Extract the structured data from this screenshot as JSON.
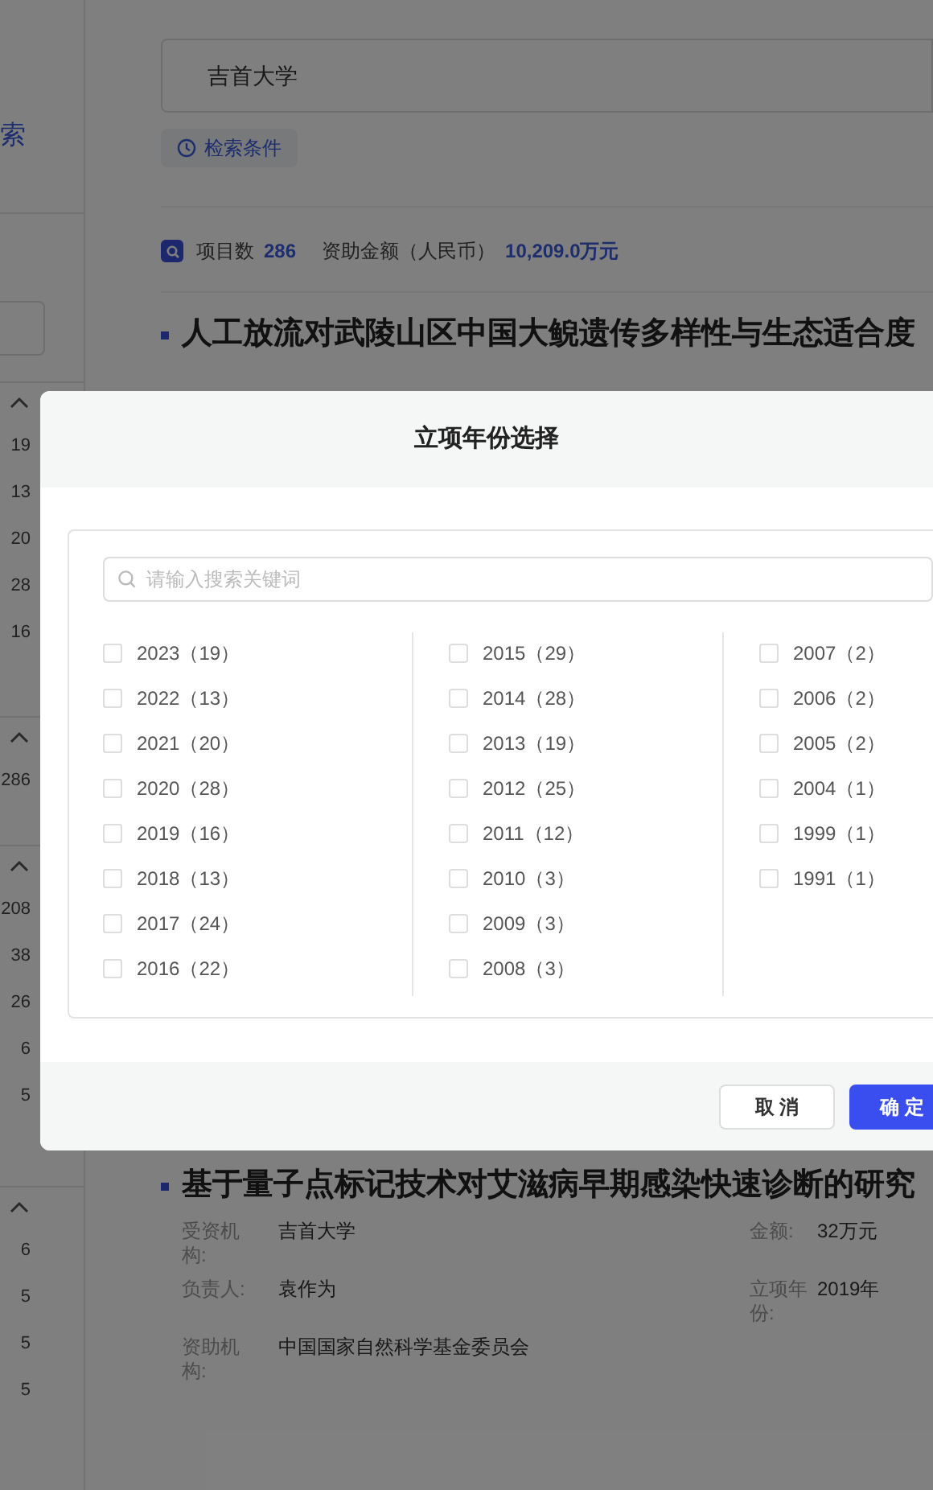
{
  "sidebar": {
    "link": "索",
    "sections": [
      {
        "expanded": true,
        "counts": [
          "19",
          "13",
          "20",
          "28",
          "16"
        ]
      },
      {
        "expanded": true,
        "counts": [
          "286"
        ]
      },
      {
        "expanded": true,
        "counts": [
          "208",
          "38",
          "26",
          "6",
          "5"
        ]
      },
      {
        "expanded": true,
        "counts": [
          "6",
          "5",
          "5",
          "5"
        ]
      }
    ]
  },
  "search": {
    "value": "吉首大学"
  },
  "conditions_button": "检索条件",
  "summary": {
    "count_label": "项目数",
    "count": "286",
    "amount_label": "资助金额（人民币）",
    "amount": "10,209.0万元"
  },
  "results": [
    {
      "title": "人工放流对武陵山区中国大鲵遗传多样性与生态适合度"
    },
    {
      "title": "基于量子点标记技术对艾滋病早期感染快速诊断的研究",
      "fields": [
        {
          "label": "受资机构:",
          "value": "吉首大学"
        },
        {
          "label": "金额:",
          "value": "32万元"
        },
        {
          "label": "负责人:",
          "value": "袁作为"
        },
        {
          "label": "立项年份:",
          "value": "2019年"
        },
        {
          "label": "资助机构:",
          "value": "中国国家自然科学基金委员会"
        }
      ]
    }
  ],
  "dialog": {
    "title": "立项年份选择",
    "search_placeholder": "请输入搜索关键词",
    "columns": [
      [
        {
          "label": "2023（19）",
          "checked": false
        },
        {
          "label": "2022（13）",
          "checked": false
        },
        {
          "label": "2021（20）",
          "checked": false
        },
        {
          "label": "2020（28）",
          "checked": false
        },
        {
          "label": "2019（16）",
          "checked": false
        },
        {
          "label": "2018（13）",
          "checked": false
        },
        {
          "label": "2017（24）",
          "checked": false
        },
        {
          "label": "2016（22）",
          "checked": false
        }
      ],
      [
        {
          "label": "2015（29）",
          "checked": false
        },
        {
          "label": "2014（28）",
          "checked": false
        },
        {
          "label": "2013（19）",
          "checked": false
        },
        {
          "label": "2012（25）",
          "checked": false
        },
        {
          "label": "2011（12）",
          "checked": false
        },
        {
          "label": "2010（3）",
          "checked": false
        },
        {
          "label": "2009（3）",
          "checked": false
        },
        {
          "label": "2008（3）",
          "checked": false
        }
      ],
      [
        {
          "label": "2007（2）",
          "checked": false
        },
        {
          "label": "2006（2）",
          "checked": false
        },
        {
          "label": "2005（2）",
          "checked": false
        },
        {
          "label": "2004（1）",
          "checked": false
        },
        {
          "label": "1999（1）",
          "checked": false
        },
        {
          "label": "1991（1）",
          "checked": false
        }
      ]
    ],
    "buttons": [
      {
        "label": "取 消",
        "kind": "secondary"
      },
      {
        "label": "确 定",
        "kind": "primary"
      }
    ]
  }
}
